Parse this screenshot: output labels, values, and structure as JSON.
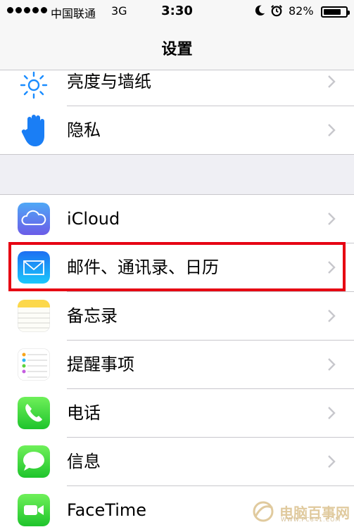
{
  "status_bar": {
    "carrier": "中国联通",
    "network": "3G",
    "time": "3:30",
    "battery_percent": "82%",
    "battery_level": 0.82
  },
  "nav": {
    "title": "设置"
  },
  "group1": [
    {
      "label": "亮度与墙纸",
      "icon": "brightness-icon"
    },
    {
      "label": "隐私",
      "icon": "privacy-hand-icon"
    }
  ],
  "group2": [
    {
      "label": "iCloud",
      "icon": "icloud-icon"
    },
    {
      "label": "邮件、通讯录、日历",
      "icon": "mail-icon"
    },
    {
      "label": "备忘录",
      "icon": "notes-icon"
    },
    {
      "label": "提醒事项",
      "icon": "reminders-icon"
    },
    {
      "label": "电话",
      "icon": "phone-icon"
    },
    {
      "label": "信息",
      "icon": "messages-icon"
    },
    {
      "label": "FaceTime",
      "icon": "facetime-icon"
    }
  ],
  "watermark": {
    "text": "电脑百事网",
    "sub": "WWW.PC841.COM"
  },
  "colors": {
    "highlight": "#e60012",
    "ios_blue": "#1a8cff"
  }
}
